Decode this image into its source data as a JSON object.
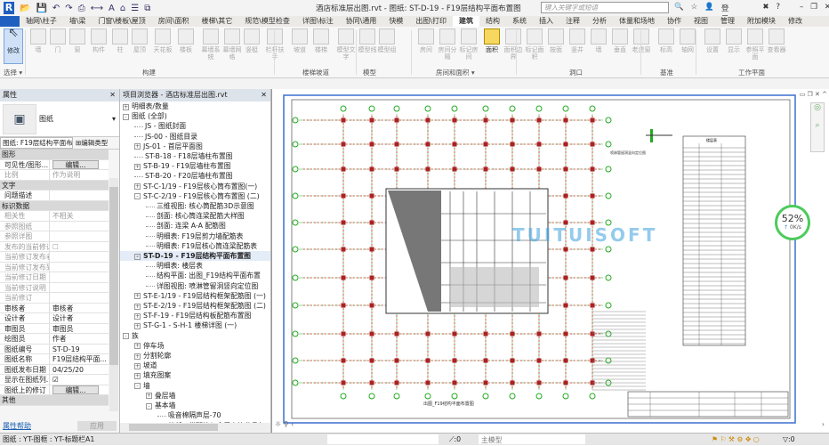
{
  "window": {
    "title": "酒店标准层出图.rvt - 图纸: ST-D-19 - F19层结构平面布置图",
    "search_placeholder": "键入关键字或短语",
    "login": "登录"
  },
  "tabs": [
    "轴网\\柱子",
    "墙\\梁",
    "门窗\\楼板\\屋顶",
    "房间\\面积",
    "楼梯\\其它",
    "规范\\模型检查",
    "详图\\标注",
    "协同\\通用",
    "快模",
    "出图\\打印",
    "建筑",
    "结构",
    "系统",
    "插入",
    "注释",
    "分析",
    "体量和场地",
    "协作",
    "视图",
    "管理",
    "附加模块",
    "修改"
  ],
  "active_tab": "建筑",
  "ribbon": {
    "tools": [
      {
        "label": "修改"
      },
      {
        "label": "墙"
      },
      {
        "label": "门"
      },
      {
        "label": "窗"
      },
      {
        "label": "构件"
      },
      {
        "label": "柱"
      },
      {
        "label": "屋顶"
      },
      {
        "label": "天花板"
      },
      {
        "label": "楼板"
      },
      {
        "label": "幕墙系统"
      },
      {
        "label": "幕墙网格"
      },
      {
        "label": "竖梃"
      },
      {
        "label": "栏杆扶手"
      },
      {
        "label": "坡道"
      },
      {
        "label": "楼梯"
      },
      {
        "label": "模型文字"
      },
      {
        "label": "模型线"
      },
      {
        "label": "模型组"
      },
      {
        "label": "房间"
      },
      {
        "label": "房间分隔"
      },
      {
        "label": "标记房间"
      },
      {
        "label": "面积"
      },
      {
        "label": "面积边界"
      },
      {
        "label": "标记面积"
      },
      {
        "label": "按面"
      },
      {
        "label": "竖井"
      },
      {
        "label": "墙"
      },
      {
        "label": "垂直"
      },
      {
        "label": "老虎窗"
      },
      {
        "label": "标高"
      },
      {
        "label": "轴网"
      },
      {
        "label": "设置"
      },
      {
        "label": "显示"
      },
      {
        "label": "参照平面"
      },
      {
        "label": "查看器"
      }
    ],
    "panels": [
      "选择 ▾",
      "构建",
      "楼梯坡道",
      "模型",
      "房间和面积 ▾",
      "洞口",
      "基准",
      "工作平面"
    ]
  },
  "properties": {
    "title": "属性",
    "type_name": "图纸",
    "selector": "图纸: F19层结构平面布",
    "edit_type": "编辑类型",
    "rows": [
      {
        "k": "图形",
        "group": true
      },
      {
        "k": "可见性/图形...",
        "v": "编辑...",
        "button": true
      },
      {
        "k": "比例",
        "v": "作为说明",
        "dim": true
      },
      {
        "k": "文字",
        "group": true
      },
      {
        "k": "问题描述",
        "v": ""
      },
      {
        "k": "标识数据",
        "group": true
      },
      {
        "k": "相关性",
        "v": "不相关",
        "dim": true
      },
      {
        "k": "参照图纸",
        "v": "",
        "dim": true
      },
      {
        "k": "参照详图",
        "v": "",
        "dim": true
      },
      {
        "k": "发布的当前修订",
        "v": "☐",
        "dim": true
      },
      {
        "k": "当前修订发布者",
        "v": "",
        "dim": true
      },
      {
        "k": "当前修订发布到",
        "v": "",
        "dim": true
      },
      {
        "k": "当前修订日期",
        "v": "",
        "dim": true
      },
      {
        "k": "当前修订说明",
        "v": "",
        "dim": true
      },
      {
        "k": "当前修订",
        "v": "",
        "dim": true
      },
      {
        "k": "审核者",
        "v": "审核者"
      },
      {
        "k": "设计者",
        "v": "设计者"
      },
      {
        "k": "审图员",
        "v": "审图员"
      },
      {
        "k": "绘图员",
        "v": "作者"
      },
      {
        "k": "图纸编号",
        "v": "ST-D-19"
      },
      {
        "k": "图纸名称",
        "v": "F19层结构平面..."
      },
      {
        "k": "图纸发布日期",
        "v": "04/25/20"
      },
      {
        "k": "显示在图纸列...",
        "v": "☑"
      },
      {
        "k": "图纸上的修订",
        "v": "编辑...",
        "button": true
      },
      {
        "k": "其他",
        "group": true
      }
    ],
    "help": "属性帮助",
    "apply": "应用"
  },
  "browser": {
    "title": "项目浏览器 - 酒店标准层出图.rvt",
    "items": [
      {
        "t": "明细表/数量",
        "d": 0,
        "e": "+"
      },
      {
        "t": "图纸 (全部)",
        "d": 0,
        "e": "-"
      },
      {
        "t": "JS - 图纸封面",
        "d": 1,
        "e": ""
      },
      {
        "t": "JS-00 - 图纸目录",
        "d": 1,
        "e": ""
      },
      {
        "t": "JS-01 - 首层平面图",
        "d": 1,
        "e": "+"
      },
      {
        "t": "ST-B-18 - F18层墙柱布置图",
        "d": 1,
        "e": ""
      },
      {
        "t": "ST-B-19 - F19层墙柱布置图",
        "d": 1,
        "e": "+"
      },
      {
        "t": "ST-B-20 - F20层墙柱布置图",
        "d": 1,
        "e": ""
      },
      {
        "t": "ST-C-1/19 - F19层核心筒布置图(一)",
        "d": 1,
        "e": "+"
      },
      {
        "t": "ST-C-2/19 - F19层核心筒布置图 (二)",
        "d": 1,
        "e": "-"
      },
      {
        "t": "三维视图: 核心筒配筋3D示意图",
        "d": 2,
        "e": ""
      },
      {
        "t": "剖面: 核心筒连梁配筋大样图",
        "d": 2,
        "e": ""
      },
      {
        "t": "剖面: 连梁 A-A 配筋图",
        "d": 2,
        "e": ""
      },
      {
        "t": "明细表: F19层剪力墙配筋表",
        "d": 2,
        "e": ""
      },
      {
        "t": "明细表: F19层核心筒连梁配筋表",
        "d": 2,
        "e": ""
      },
      {
        "t": "ST-D-19 - F19层结构平面布置图",
        "d": 1,
        "e": "-",
        "bold": true
      },
      {
        "t": "明细表: 楼层表",
        "d": 2,
        "e": ""
      },
      {
        "t": "结构平面: 出图_F19结构平面布置",
        "d": 2,
        "e": ""
      },
      {
        "t": "详图视图: 喷淋管留洞竖向定位图",
        "d": 2,
        "e": ""
      },
      {
        "t": "ST-E-1/19 - F19层结构框架配筋图 (一)",
        "d": 1,
        "e": "+"
      },
      {
        "t": "ST-E-2/19 - F19层结构框架配筋图 (二)",
        "d": 1,
        "e": "+"
      },
      {
        "t": "ST-F-19 - F19层结构板配筋布置图",
        "d": 1,
        "e": "+"
      },
      {
        "t": "ST-G-1 - S-H-1 楼梯详图 (一)",
        "d": 1,
        "e": "+"
      },
      {
        "t": "族",
        "d": 0,
        "e": "-"
      },
      {
        "t": "停车场",
        "d": 1,
        "e": "+"
      },
      {
        "t": "分割轮廓",
        "d": 1,
        "e": "+"
      },
      {
        "t": "坡道",
        "d": 1,
        "e": "+"
      },
      {
        "t": "填充图案",
        "d": 1,
        "e": "+"
      },
      {
        "t": "墙",
        "d": 1,
        "e": "-"
      },
      {
        "t": "叠层墙",
        "d": 2,
        "e": "+"
      },
      {
        "t": "基本墙",
        "d": 2,
        "e": "-"
      },
      {
        "t": "吸音棉隔声层-70",
        "d": 3,
        "e": ""
      },
      {
        "t": "外部 - 带砌块与金属立筋龙骨复",
        "d": 3,
        "e": ""
      },
      {
        "t": "外部 - 带砖与金属立筋龙骨复",
        "d": 3,
        "e": ""
      }
    ]
  },
  "drawing": {
    "title_caption": "出图_F19结构平面布置图",
    "detail_caption": "喷淋管留洞竖向定位图",
    "table_title": "楼层表"
  },
  "watermark": "TUITUISOFT",
  "speed": {
    "percent": "52%",
    "rate": "0K/s"
  },
  "status": {
    "left": "图纸 : YT-图框 : YT-标题栏A1",
    "workset_count": ":0",
    "model": "主模型",
    "filter": ":0"
  }
}
